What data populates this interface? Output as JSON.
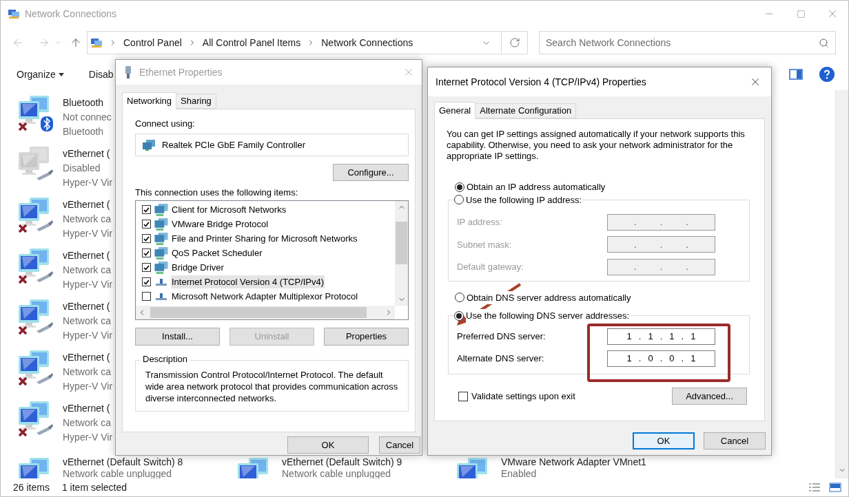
{
  "window": {
    "title": "Network Connections"
  },
  "address_bar": {
    "crumbs": [
      "Control Panel",
      "All Control Panel Items",
      "Network Connections"
    ]
  },
  "search": {
    "placeholder": "Search Network Connections"
  },
  "command_bar": {
    "items": [
      "Organize",
      "Disab"
    ]
  },
  "connections": [
    {
      "name": "Bluetooth",
      "status": "Not connec",
      "device": "Bluetooth",
      "kind": "bluetooth",
      "disabled": false,
      "error": true
    },
    {
      "name": "vEthernet (",
      "status": "Disabled",
      "device": "Hyper-V Vir",
      "kind": "ethernet",
      "disabled": true,
      "error": false
    },
    {
      "name": "vEthernet (",
      "status": "Network ca",
      "device": "Hyper-V Vir",
      "kind": "ethernet",
      "disabled": false,
      "error": true
    },
    {
      "name": "vEthernet (",
      "status": "Network ca",
      "device": "Hyper-V Vir",
      "kind": "ethernet",
      "disabled": false,
      "error": true
    },
    {
      "name": "vEthernet (",
      "status": "Network ca",
      "device": "Hyper-V Vir",
      "kind": "ethernet",
      "disabled": false,
      "error": true
    },
    {
      "name": "vEthernet (",
      "status": "Network ca",
      "device": "Hyper-V Vir",
      "kind": "ethernet",
      "disabled": false,
      "error": true
    },
    {
      "name": "vEthernet (",
      "status": "Network ca",
      "device": "Hyper-V Vir",
      "kind": "ethernet",
      "disabled": false,
      "error": true
    }
  ],
  "last_row": [
    {
      "name": "vEthernet (Default Switch) 8",
      "status": "Network cable unplugged",
      "kind": "plain",
      "disabled": false,
      "error": false
    },
    {
      "name": "vEthernet (Default Switch) 9",
      "status": "Network cable unplugged",
      "kind": "plain",
      "disabled": false,
      "error": false
    },
    {
      "name": "VMware Network Adapter VMnet1",
      "status": "Enabled",
      "kind": "plain",
      "disabled": false,
      "error": false
    }
  ],
  "status_bar": {
    "count": "26 items",
    "selection": "1 item selected"
  },
  "ethernet_dialog": {
    "title": "Ethernet Properties",
    "tabs": [
      {
        "label": "Networking",
        "selected": true
      },
      {
        "label": "Sharing",
        "selected": false
      }
    ],
    "connect_label": "Connect using:",
    "adapter": "Realtek PCIe GbE Family Controller",
    "configure": "Configure...",
    "items_label": "This connection uses the following items:",
    "components": [
      {
        "label": "Client for Microsoft Networks",
        "checked": true,
        "selected": false,
        "kind": "service"
      },
      {
        "label": "VMware Bridge Protocol",
        "checked": true,
        "selected": false,
        "kind": "service"
      },
      {
        "label": "File and Printer Sharing for Microsoft Networks",
        "checked": true,
        "selected": false,
        "kind": "service"
      },
      {
        "label": "QoS Packet Scheduler",
        "checked": true,
        "selected": false,
        "kind": "service"
      },
      {
        "label": "Bridge Driver",
        "checked": true,
        "selected": false,
        "kind": "service"
      },
      {
        "label": "Internet Protocol Version 4 (TCP/IPv4)",
        "checked": true,
        "selected": true,
        "kind": "protocol"
      },
      {
        "label": "Microsoft Network Adapter Multiplexor Protocol",
        "checked": false,
        "selected": false,
        "kind": "protocol"
      }
    ],
    "actions": [
      {
        "label": "Install...",
        "disabled": false
      },
      {
        "label": "Uninstall",
        "disabled": true
      },
      {
        "label": "Properties",
        "disabled": false
      }
    ],
    "description_title": "Description",
    "description": "Transmission Control Protocol/Internet Protocol. The default wide area network protocol that provides communication across diverse interconnected networks.",
    "buttons": [
      "OK",
      "Cancel"
    ]
  },
  "ipv4_dialog": {
    "title": "Internet Protocol Version 4 (TCP/IPv4) Properties",
    "tabs": [
      {
        "label": "General",
        "selected": true
      },
      {
        "label": "Alternate Configuration",
        "selected": false
      }
    ],
    "intro": "You can get IP settings assigned automatically if your network supports this capability. Otherwise, you need to ask your network administrator for the appropriate IP settings.",
    "ip_modes": [
      {
        "label": "Obtain an IP address automatically",
        "selected": true
      },
      {
        "label": "Use the following IP address:",
        "selected": false
      }
    ],
    "ip_disabled": true,
    "ip_fields": [
      {
        "label": "IP address:",
        "value": "..."
      },
      {
        "label": "Subnet mask:",
        "value": "..."
      },
      {
        "label": "Default gateway:",
        "value": "..."
      }
    ],
    "dns_modes": [
      {
        "label": "Obtain DNS server address automatically",
        "selected": false
      },
      {
        "label": "Use the following DNS server addresses:",
        "selected": true
      }
    ],
    "dns_disabled": false,
    "dns_fields": [
      {
        "label": "Preferred DNS server:",
        "value": "1.1.1.1"
      },
      {
        "label": "Alternate DNS server:",
        "value": "1.0.0.1"
      }
    ],
    "validate": {
      "label": "Validate settings upon exit",
      "checked": false
    },
    "advanced": "Advanced...",
    "buttons": [
      {
        "label": "OK",
        "default": true
      },
      {
        "label": "Cancel",
        "default": false
      }
    ]
  }
}
